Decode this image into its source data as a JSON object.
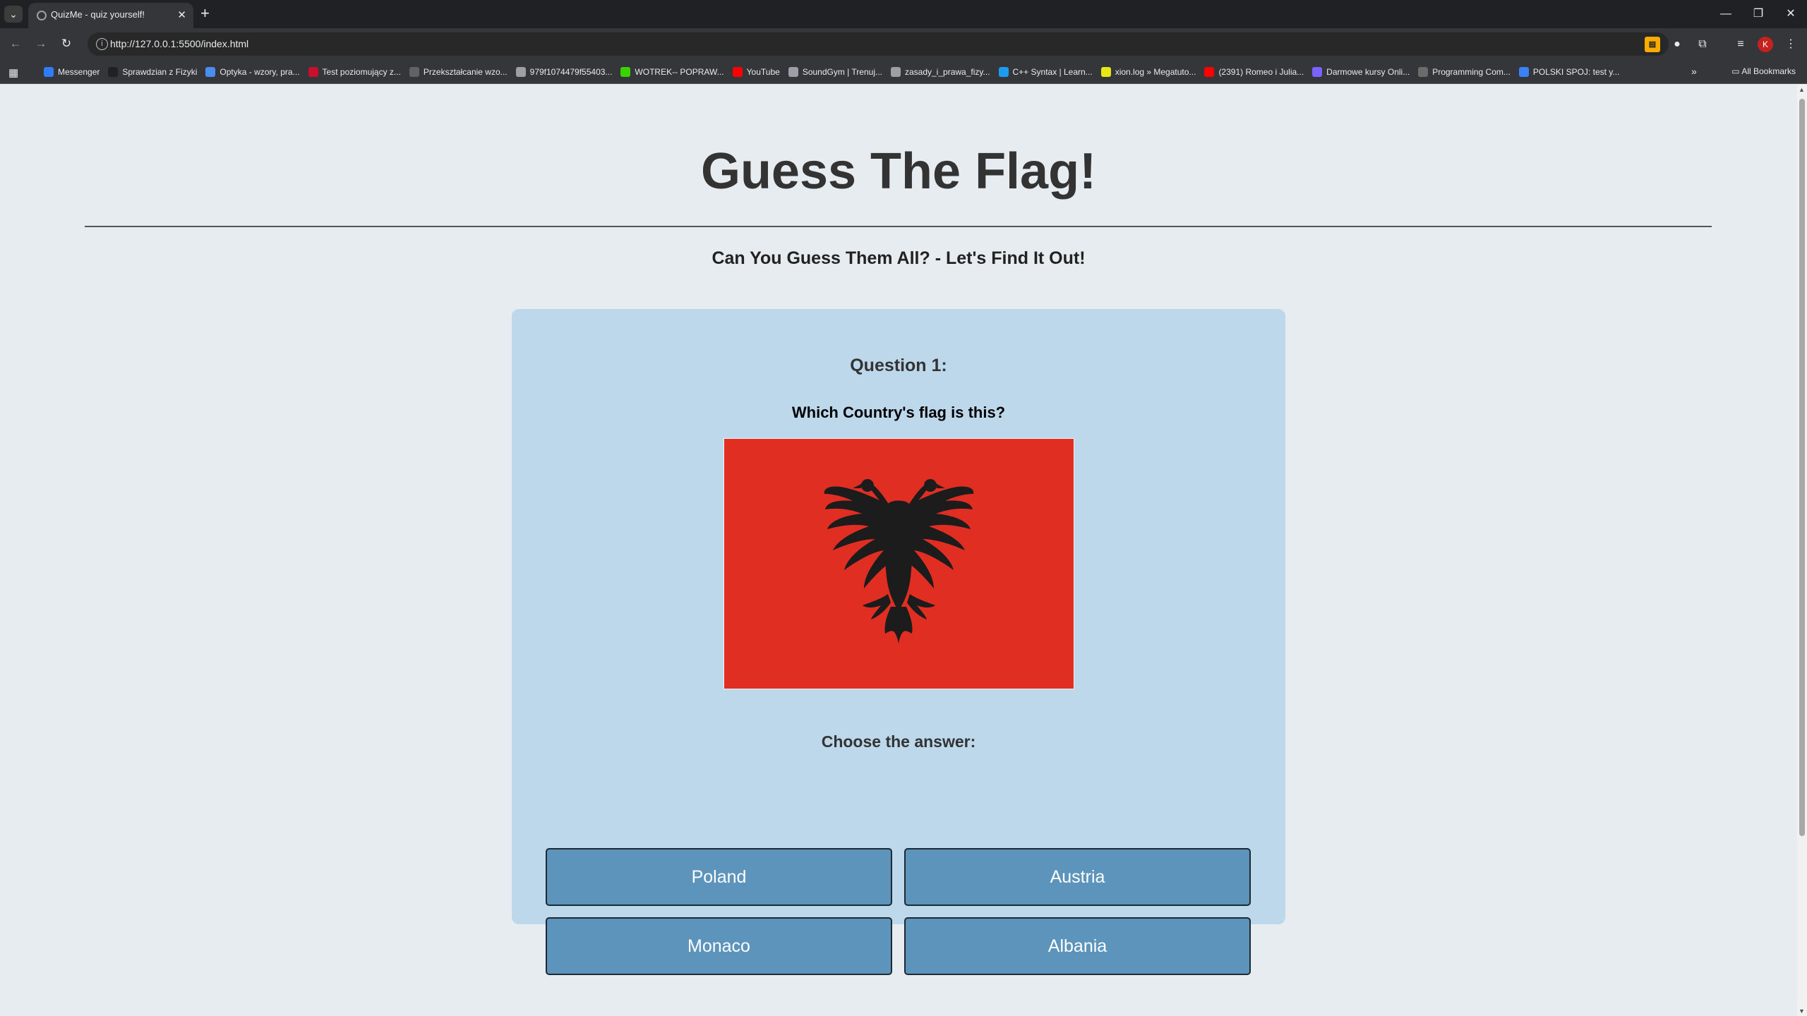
{
  "browser": {
    "tab_title": "QuizMe - quiz yourself!",
    "url": "http://127.0.0.1:5500/index.html",
    "profile_initial": "K",
    "all_bookmarks_label": "All Bookmarks",
    "bookmarks": [
      {
        "label": "Messenger",
        "color": "#2f7cf6"
      },
      {
        "label": "Sprawdzian z Fizyki",
        "color": "#202124"
      },
      {
        "label": "Optyka - wzory, pra...",
        "color": "#4a8df0"
      },
      {
        "label": "Test poziomujący z...",
        "color": "#c8102e"
      },
      {
        "label": "Przekształcanie wzo...",
        "color": "#5f6368"
      },
      {
        "label": "979f1074479f55403...",
        "color": "#9aa0a6"
      },
      {
        "label": "WOTREK-- POPRAW...",
        "color": "#3ad100"
      },
      {
        "label": "YouTube",
        "color": "#ff0000"
      },
      {
        "label": "SoundGym | Trenuj...",
        "color": "#9aa0a6"
      },
      {
        "label": "zasady_i_prawa_fizy...",
        "color": "#9aa0a6"
      },
      {
        "label": "C++ Syntax | Learn...",
        "color": "#1d9bf0"
      },
      {
        "label": "xion.log » Megatuto...",
        "color": "#e8e815"
      },
      {
        "label": "(2391) Romeo i Julia...",
        "color": "#ff0000"
      },
      {
        "label": "Darmowe kursy Onli...",
        "color": "#7b61ff"
      },
      {
        "label": "Programming Com...",
        "color": "#6b6b6b"
      },
      {
        "label": "POLSKI SPOJ: test y...",
        "color": "#3b82f6"
      }
    ]
  },
  "page": {
    "title": "Guess The Flag!",
    "subtitle": "Can You Guess Them All? - Let's Find It Out!",
    "question_number": "Question 1:",
    "question_text": "Which Country's flag is this?",
    "flag_image": "albania-flag",
    "choose_label": "Choose the answer:",
    "answers": [
      "Poland",
      "Austria",
      "Monaco",
      "Albania"
    ]
  },
  "colors": {
    "page_bg": "#e6ecef",
    "card_bg": "#bdd7eb",
    "button_bg": "#5d94bb",
    "flag_red": "#e12e22",
    "eagle": "#1c1c1c"
  }
}
